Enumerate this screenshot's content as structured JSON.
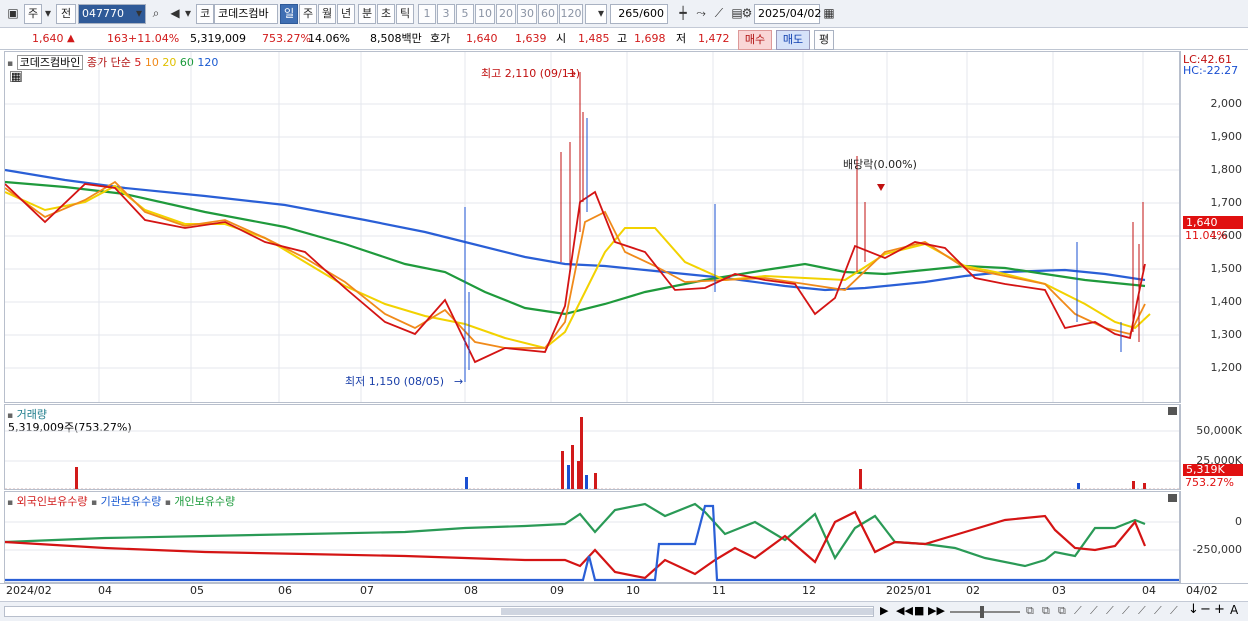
{
  "toolbar": {
    "market_a": "주",
    "market_b": "전",
    "code": "047770",
    "name_prefix": "코",
    "name": "코데즈컴바",
    "periods": [
      "일",
      "주",
      "월",
      "년",
      "분",
      "초",
      "틱"
    ],
    "active_period": "일",
    "intervals": [
      "1",
      "3",
      "5",
      "10",
      "20",
      "30",
      "60",
      "120"
    ],
    "count": "265",
    "count_max": "/600",
    "date": "2025/04/02"
  },
  "quote": {
    "price": "1,640",
    "up_arrow": "▲",
    "change": "163",
    "change_rate": "+11.04%",
    "volume": "5,319,009",
    "volume_rate": "753.27%",
    "turnover": "14.06%",
    "amount": "8,508백만",
    "ask_label": "호가",
    "ask": "1,640",
    "bid": "1,639",
    "open_label": "시",
    "open": "1,485",
    "high_label": "고",
    "high": "1,698",
    "low_label": "저",
    "low": "1,472",
    "buy_label": "매수",
    "sell_label": "매도",
    "eval_label": "평"
  },
  "price_panel": {
    "legend_name": "코데즈컴바인",
    "legend_type": "종가 단순",
    "ma": [
      {
        "label": "5",
        "color": "#d11a1a"
      },
      {
        "label": "10",
        "color": "#f08a1a"
      },
      {
        "label": "20",
        "color": "#f0d000"
      },
      {
        "label": "60",
        "color": "#1a9a3a"
      },
      {
        "label": "120",
        "color": "#1a5ad1"
      }
    ],
    "lc": "LC:42.61",
    "hc": "HC:-22.27",
    "high_note": "최고 2,110 (09/11)",
    "low_note": "최저 1,150 (08/05)",
    "dividend_note": "배당락(0.00%)",
    "current_price": "1,640",
    "current_rate": "11.04%",
    "y_ticks": [
      "2,000",
      "1,900",
      "1,800",
      "1,700",
      "1,600",
      "1,500",
      "1,400",
      "1,300",
      "1,200"
    ]
  },
  "volume_panel": {
    "title": "거래량",
    "value": "5,319,009주(753.27%)",
    "y_ticks": [
      "50,000K",
      "25,000K"
    ],
    "current": "5,319K",
    "current_rate": "753.27%"
  },
  "holding_panel": {
    "series": [
      {
        "label": "외국인보유수량",
        "color": "#d11a1a"
      },
      {
        "label": "기관보유수량",
        "color": "#1a5ad1"
      },
      {
        "label": "개인보유수량",
        "color": "#1a9a3a"
      }
    ],
    "y_ticks": [
      "0",
      "-250,000"
    ]
  },
  "x_axis": {
    "labels": [
      "2024/02",
      "04",
      "05",
      "06",
      "07",
      "08",
      "09",
      "10",
      "11",
      "12",
      "2025/01",
      "02",
      "03",
      "04"
    ],
    "end_label": "04/02"
  },
  "chart_data": {
    "type": "line",
    "title": "",
    "ylim": [
      1100,
      2150
    ],
    "price_approx": [
      1720,
      1700,
      1660,
      1640,
      1700,
      1740,
      1700,
      1680,
      1650,
      1630,
      1620,
      1640,
      1600,
      1590,
      1570,
      1550,
      1500,
      1460,
      1420,
      1380,
      1350,
      1330,
      1320,
      1380,
      1400,
      1180,
      1240,
      1260,
      1250,
      1270,
      1520,
      1800,
      1700,
      1600,
      1580,
      1500,
      1450,
      1440,
      1480,
      1500,
      1460,
      1450,
      1420,
      1400,
      1420,
      1550,
      1560,
      1540,
      1560,
      1540,
      1520,
      1500,
      1480,
      1460,
      1440,
      1420,
      1400,
      1340,
      1320,
      1350,
      1290,
      1640
    ],
    "highs": [
      {
        "date": "09/11",
        "value": 2110
      }
    ],
    "lows": [
      {
        "date": "08/05",
        "value": 1150
      }
    ],
    "volume_peak": "09/11",
    "xlabel": "",
    "ylabel": ""
  }
}
